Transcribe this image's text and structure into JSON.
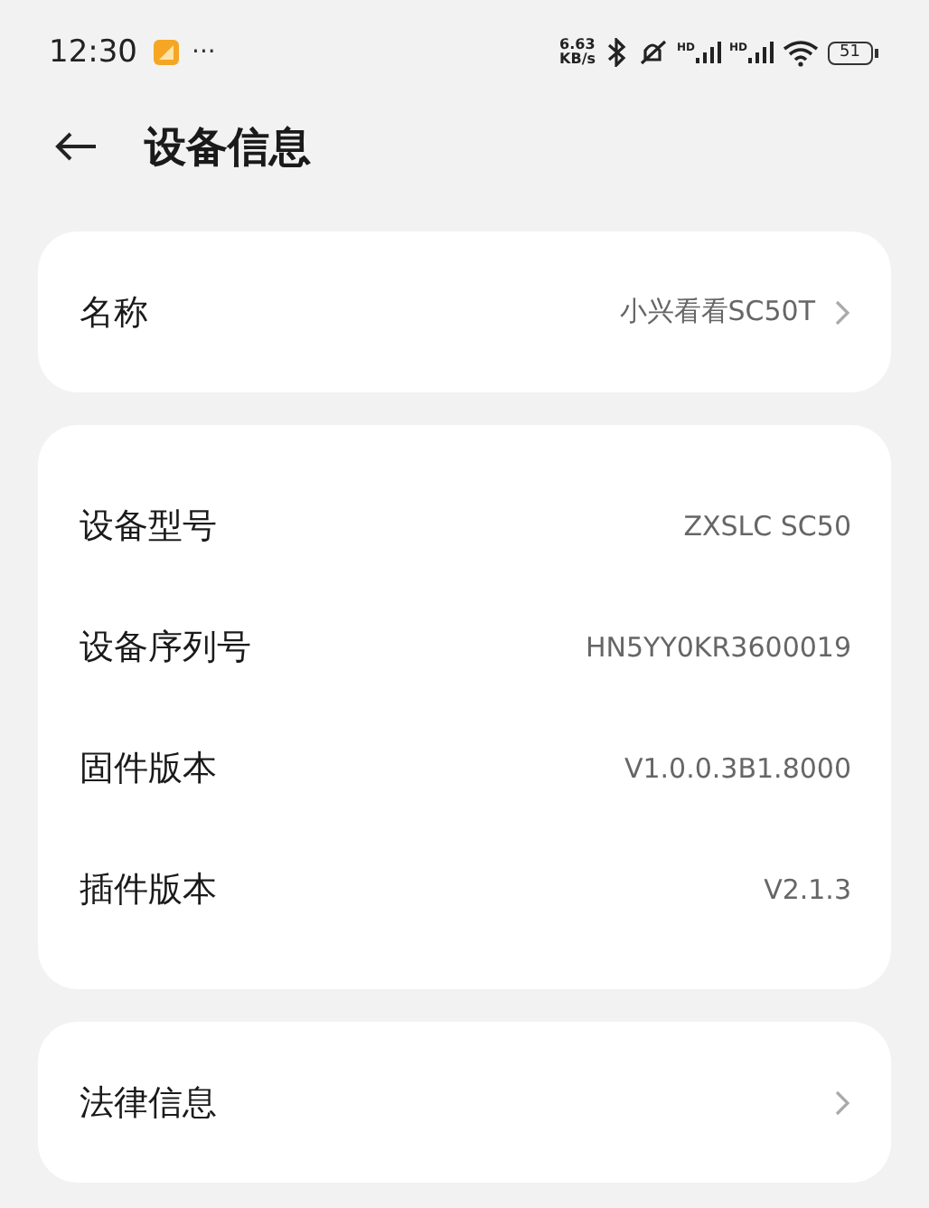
{
  "status_bar": {
    "time": "12:30",
    "more": "···",
    "speed_value": "6.63",
    "speed_unit": "KB/s",
    "signal_labels": [
      "HD",
      "HD"
    ],
    "battery": "51"
  },
  "header": {
    "title": "设备信息"
  },
  "sections": [
    {
      "rows": [
        {
          "kind": "link",
          "label": "名称",
          "value": "小兴看看SC50T"
        }
      ]
    },
    {
      "rows": [
        {
          "kind": "info",
          "label": "设备型号",
          "value": "ZXSLC SC50"
        },
        {
          "kind": "info",
          "label": "设备序列号",
          "value": "HN5YY0KR3600019"
        },
        {
          "kind": "info",
          "label": "固件版本",
          "value": "V1.0.0.3B1.8000"
        },
        {
          "kind": "info",
          "label": "插件版本",
          "value": "V2.1.3"
        }
      ]
    },
    {
      "rows": [
        {
          "kind": "link",
          "label": "法律信息"
        }
      ]
    }
  ]
}
